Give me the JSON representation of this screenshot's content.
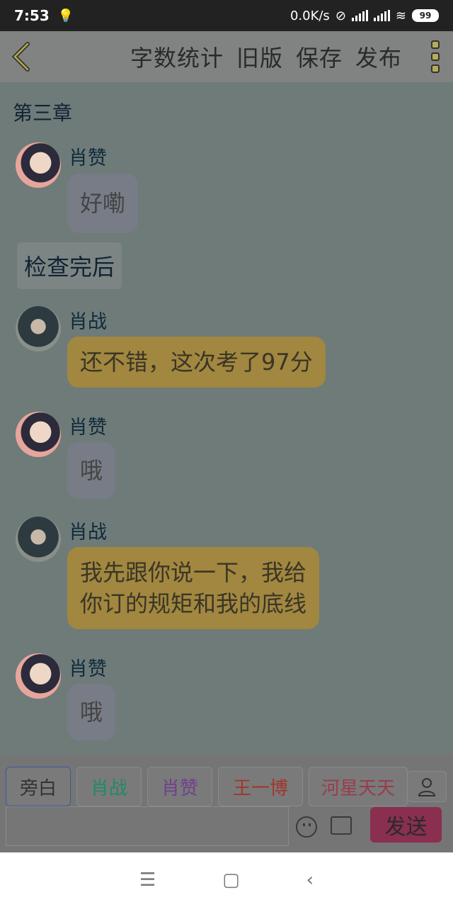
{
  "status_bar": {
    "time": "7:53",
    "network_speed": "0.0K/s",
    "battery": "99"
  },
  "toolbar": {
    "actions": [
      "字数统计",
      "旧版",
      "保存",
      "发布"
    ]
  },
  "chat": {
    "chapter_title": "第三章",
    "messages": [
      {
        "sender": "肖赞",
        "text": "好嘞",
        "style": "grey"
      },
      {
        "sender": "肖战",
        "text": "还不错，这次考了97分",
        "style": "gold"
      },
      {
        "sender": "肖赞",
        "text": "哦",
        "style": "grey"
      },
      {
        "sender": "肖战",
        "text": "我先跟你说一下，我给\n你订的规矩和我的底线",
        "style": "gold"
      },
      {
        "sender": "肖赞",
        "text": "哦",
        "style": "grey"
      }
    ],
    "narration": "检查完后"
  },
  "roles": [
    {
      "label": "旁白",
      "color": "#333333"
    },
    {
      "label": "肖战",
      "color": "#1f8a68"
    },
    {
      "label": "肖赞",
      "color": "#6f3f8f"
    },
    {
      "label": "王一博",
      "color": "#a3352c"
    },
    {
      "label": "河星天天",
      "color": "#9a3b4d"
    }
  ],
  "input": {
    "send_label": "发送"
  },
  "nav": {
    "menu": "☰",
    "home": "▢",
    "back": "‹"
  }
}
